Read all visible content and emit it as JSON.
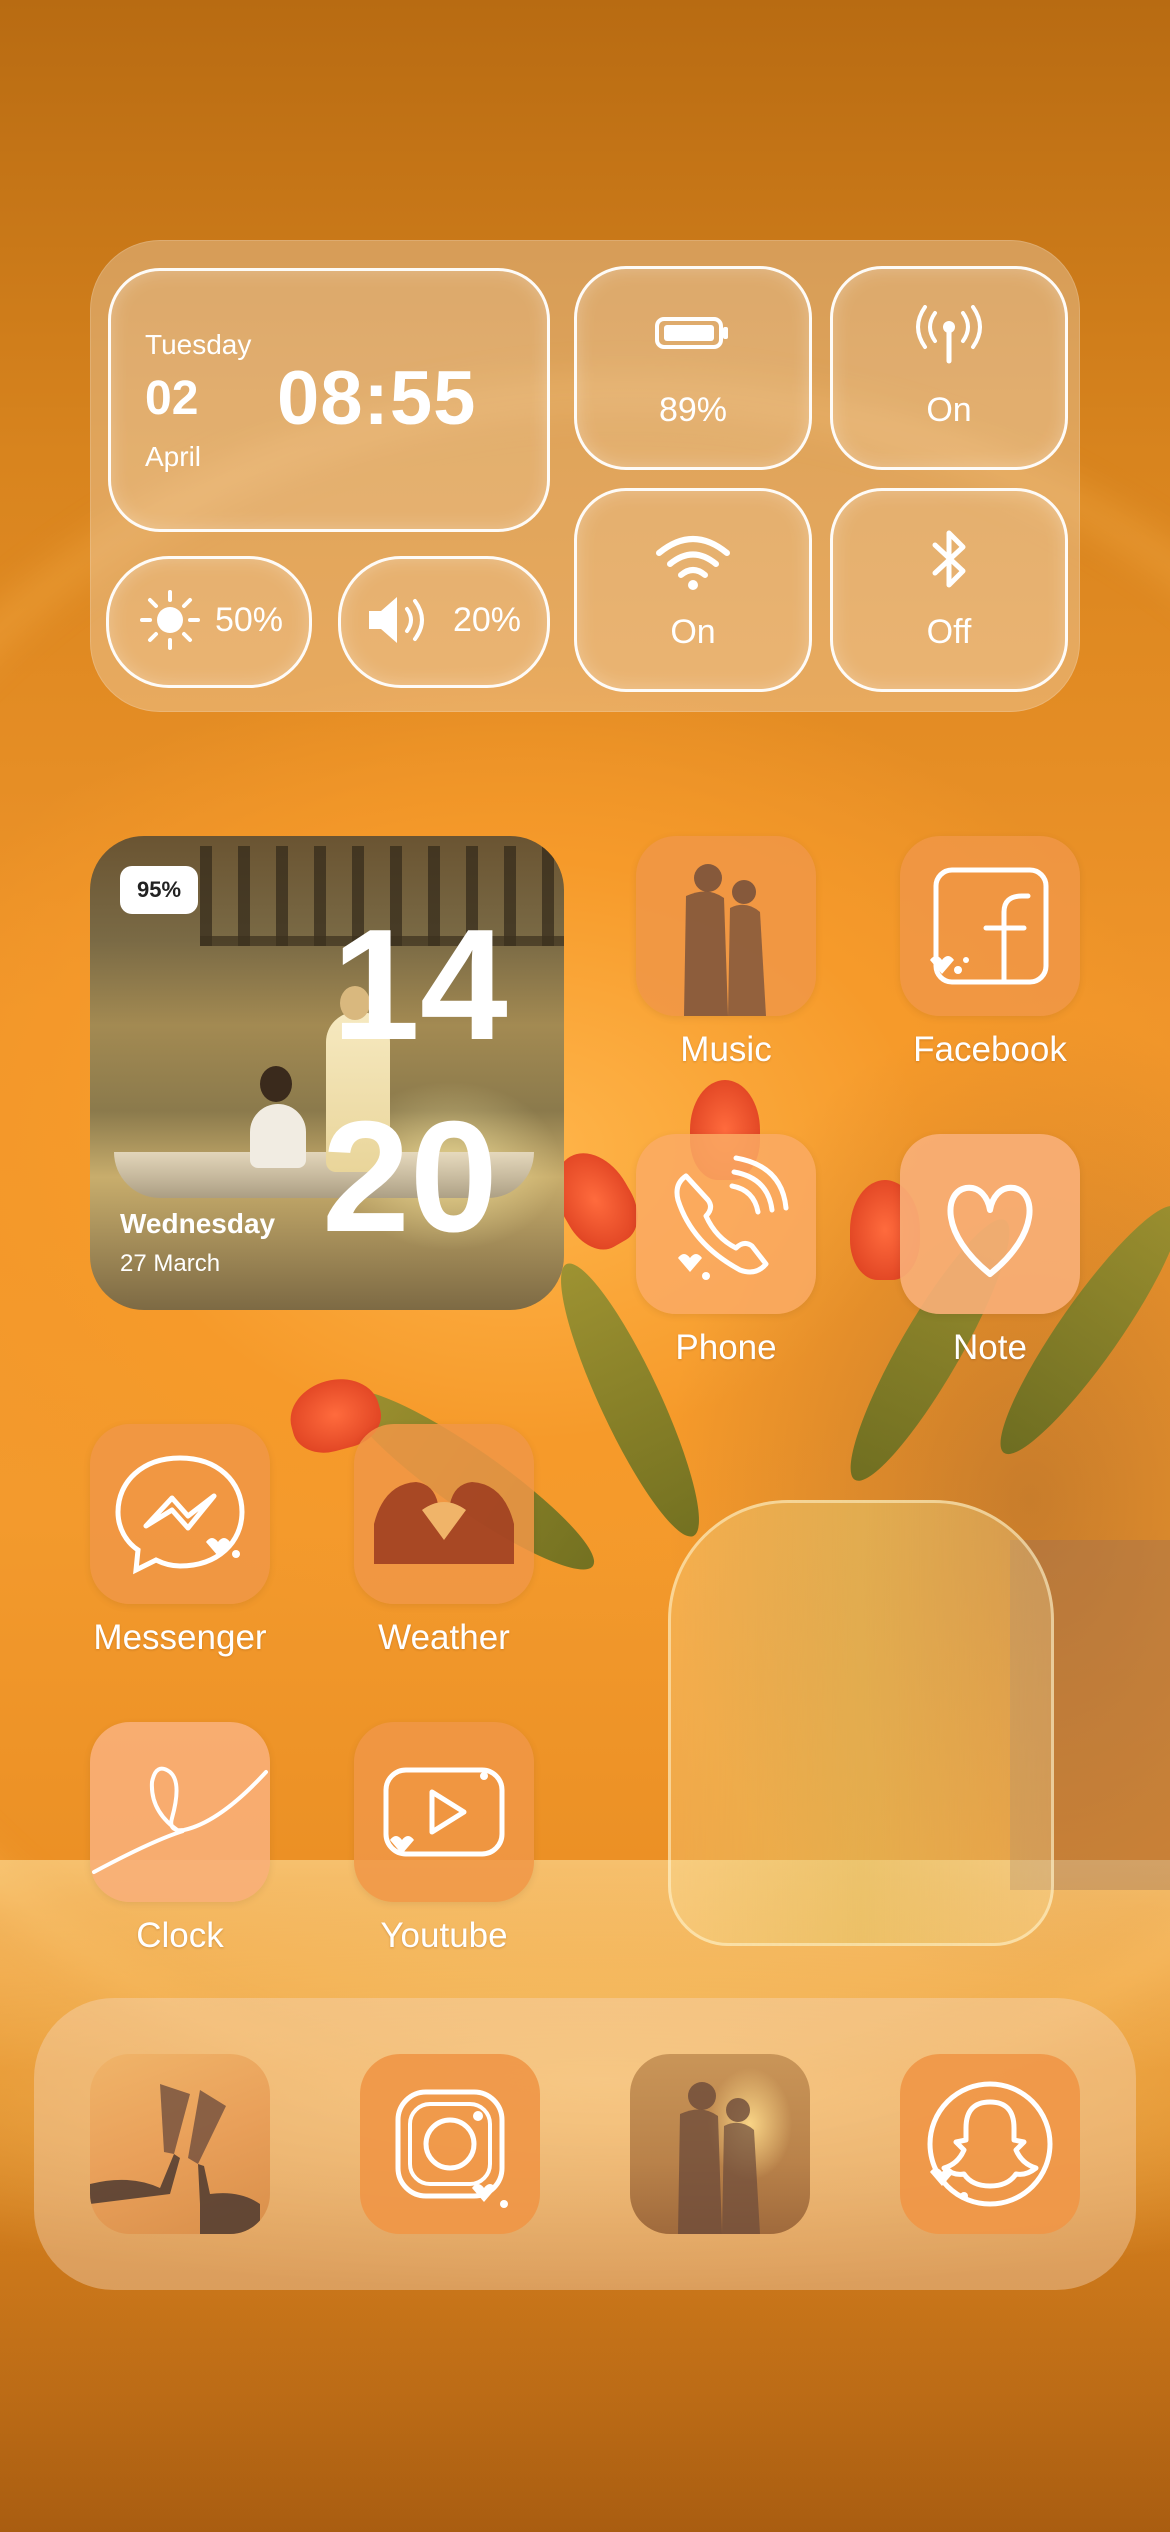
{
  "control_widget": {
    "day_name": "Tuesday",
    "day_number": "02",
    "month": "April",
    "time": "08:55",
    "battery_label": "89%",
    "cellular_label": "On",
    "wifi_label": "On",
    "bluetooth_label": "Off",
    "brightness_label": "50%",
    "volume_label": "20%"
  },
  "photo_widget": {
    "battery_badge": "95%",
    "hour": "14",
    "minute": "20",
    "day_name": "Wednesday",
    "date": "27 March"
  },
  "apps": {
    "music": "Music",
    "facebook": "Facebook",
    "phone": "Phone",
    "note": "Note",
    "messenger": "Messenger",
    "weather": "Weather",
    "clock": "Clock",
    "youtube": "Youtube"
  },
  "dock": {
    "items": [
      "toast-photo-icon",
      "instagram-icon",
      "couple-photo-icon",
      "snapchat-icon"
    ]
  },
  "colors": {
    "accent": "#f39a2d",
    "icon_bg": "#f0964a",
    "text": "#ffffff"
  }
}
